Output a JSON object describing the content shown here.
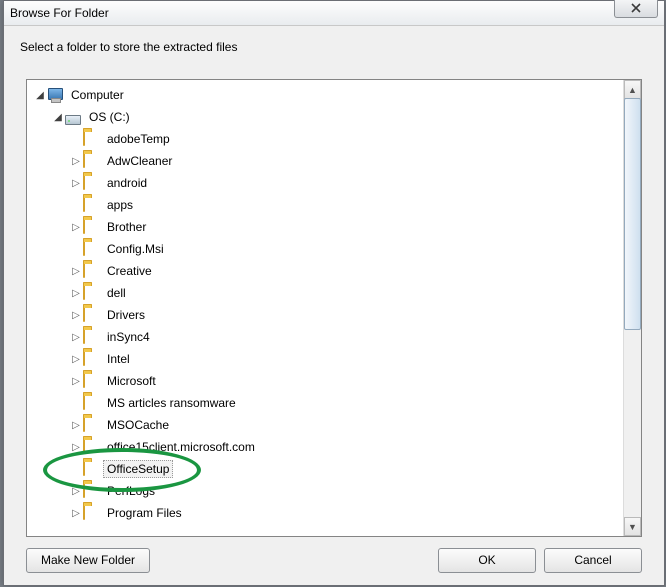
{
  "title": "Browse For Folder",
  "instruction": "Select a folder to store the extracted files",
  "root": {
    "label": "Computer"
  },
  "drive": {
    "label": "OS (C:)"
  },
  "folders": [
    {
      "label": "adobeTemp",
      "exp": false
    },
    {
      "label": "AdwCleaner",
      "exp": true
    },
    {
      "label": "android",
      "exp": true
    },
    {
      "label": "apps",
      "exp": false
    },
    {
      "label": "Brother",
      "exp": true
    },
    {
      "label": "Config.Msi",
      "exp": false
    },
    {
      "label": "Creative",
      "exp": true
    },
    {
      "label": "dell",
      "exp": true
    },
    {
      "label": "Drivers",
      "exp": true
    },
    {
      "label": "inSync4",
      "exp": true
    },
    {
      "label": "Intel",
      "exp": true
    },
    {
      "label": "Microsoft",
      "exp": true
    },
    {
      "label": "MS articles ransomware",
      "exp": false
    },
    {
      "label": "MSOCache",
      "exp": true
    },
    {
      "label": "office15client.microsoft.com",
      "exp": true
    },
    {
      "label": "OfficeSetup",
      "exp": false,
      "selected": true,
      "circled": true
    },
    {
      "label": "PerfLogs",
      "exp": true
    },
    {
      "label": "Program Files",
      "exp": true
    }
  ],
  "buttons": {
    "make_new": "Make New Folder",
    "ok": "OK",
    "cancel": "Cancel"
  }
}
